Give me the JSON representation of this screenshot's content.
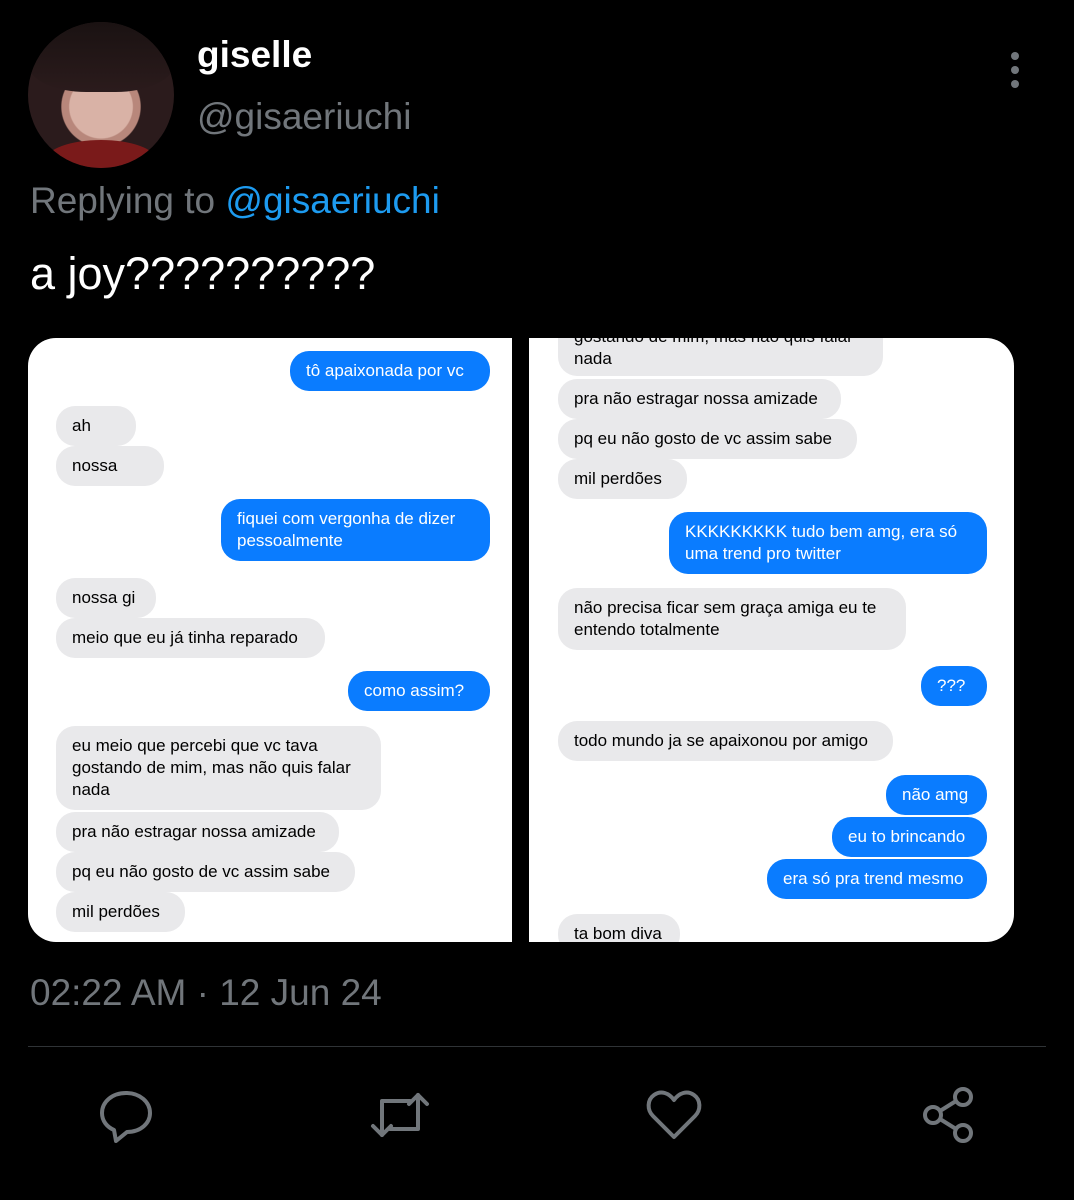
{
  "author": {
    "name": "giselle",
    "handle": "@gisaeriuchi"
  },
  "reply": {
    "prefix": "Replying to ",
    "mention": "@gisaeriuchi"
  },
  "tweet": {
    "text": "a joy??????????"
  },
  "timestamp": "02:22 AM · 12 Jun 24",
  "chat_left": [
    {
      "dir": "out",
      "text": "tô apaixonada por vc"
    },
    {
      "dir": "in",
      "text": "ah"
    },
    {
      "dir": "in",
      "text": "nossa"
    },
    {
      "dir": "out",
      "text": "fiquei com vergonha de dizer\npessoalmente"
    },
    {
      "dir": "in",
      "text": "nossa gi"
    },
    {
      "dir": "in",
      "text": "meio que eu já tinha reparado"
    },
    {
      "dir": "out",
      "text": "como assim?"
    },
    {
      "dir": "in",
      "text": "eu meio que percebi que vc tava\ngostando de mim, mas não quis falar\nnada"
    },
    {
      "dir": "in",
      "text": "pra não estragar nossa amizade"
    },
    {
      "dir": "in",
      "text": "pq eu não gosto de vc assim sabe"
    },
    {
      "dir": "in",
      "text": "mil perdões"
    }
  ],
  "chat_right": [
    {
      "dir": "in",
      "text": "gostando de mim, mas não quis falar\nnada"
    },
    {
      "dir": "in",
      "text": "pra não estragar nossa amizade"
    },
    {
      "dir": "in",
      "text": "pq eu não gosto de vc assim sabe"
    },
    {
      "dir": "in",
      "text": "mil perdões"
    },
    {
      "dir": "out",
      "text": "KKKKKKKKK tudo bem amg, era só\numa trend pro twitter"
    },
    {
      "dir": "in",
      "text": "não precisa ficar sem graça amiga eu te\nentendo totalmente"
    },
    {
      "dir": "out",
      "text": "???"
    },
    {
      "dir": "in",
      "text": "todo mundo ja se apaixonou por amigo"
    },
    {
      "dir": "out",
      "text": "não amg"
    },
    {
      "dir": "out",
      "text": "eu to brincando"
    },
    {
      "dir": "out",
      "text": "era só pra trend mesmo"
    },
    {
      "dir": "in",
      "text": "ta bom diva"
    }
  ],
  "actions": [
    {
      "name": "reply-icon"
    },
    {
      "name": "retweet-icon"
    },
    {
      "name": "like-icon"
    },
    {
      "name": "share-icon"
    }
  ],
  "colors": {
    "accent": "#1d9bf0",
    "imessage_blue": "#0a7cff",
    "imessage_gray": "#e9e9eb",
    "muted": "#71767b"
  }
}
